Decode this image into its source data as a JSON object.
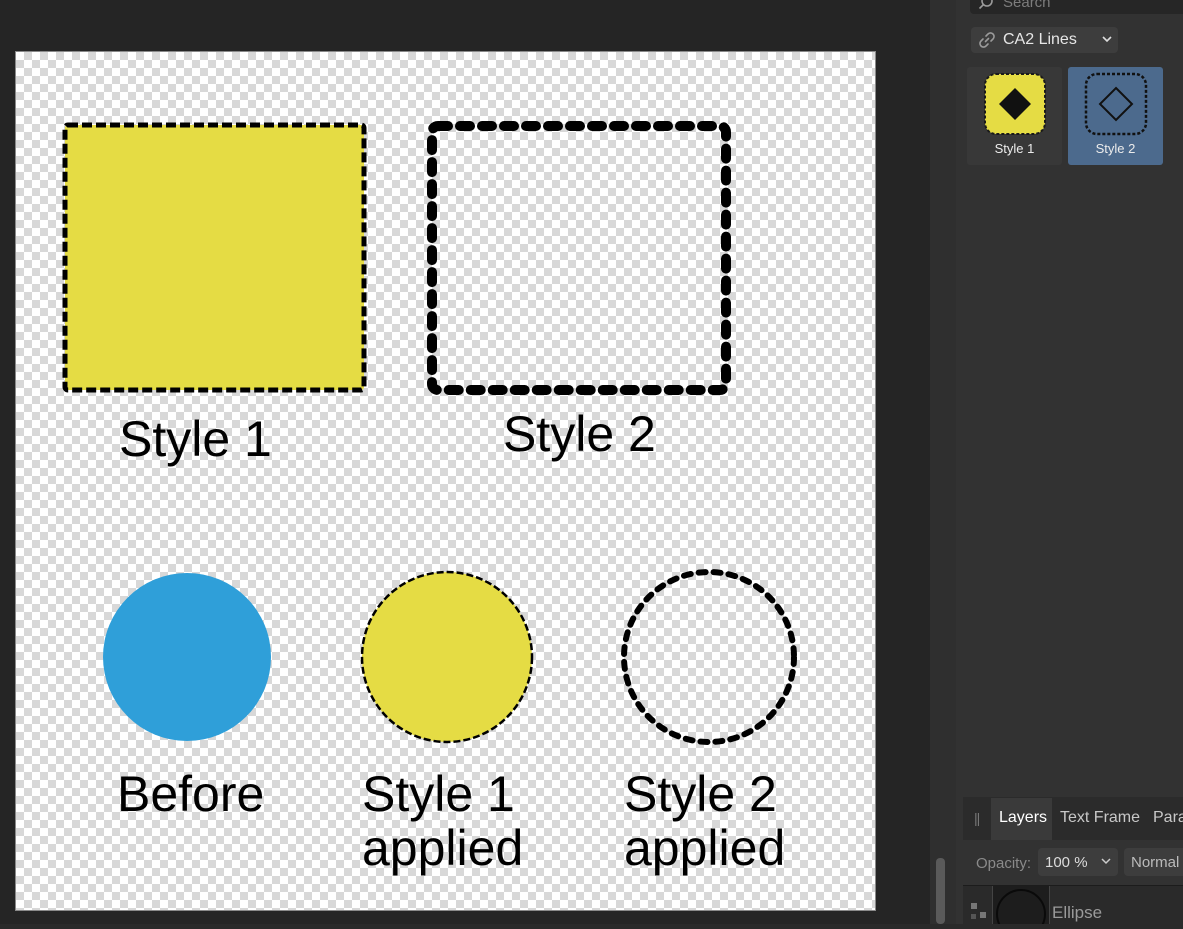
{
  "canvas": {
    "captions": {
      "square_style1": "Style 1",
      "square_style2": "Style 2",
      "circle_before": "Before",
      "circle_style1": [
        "Style 1",
        "applied"
      ],
      "circle_style2": [
        "Style 2",
        "applied"
      ]
    },
    "colors": {
      "yellow": "#e5dc44",
      "blue": "#2f9fd9",
      "stroke": "#000000"
    }
  },
  "panel": {
    "search": {
      "placeholder": "Search"
    },
    "category": {
      "label": "CA2 Lines",
      "icon": "link-icon"
    },
    "styles": [
      {
        "label": "Style 1",
        "selected": false,
        "icon": "diamond-filled-icon"
      },
      {
        "label": "Style 2",
        "selected": true,
        "icon": "diamond-outline-icon"
      }
    ],
    "tabs": [
      "Layers",
      "Text Frame",
      "Para"
    ],
    "opacity": {
      "label": "Opacity:",
      "value": "100 %"
    },
    "blend_mode": "Normal",
    "layer": {
      "name": "Ellipse"
    }
  }
}
